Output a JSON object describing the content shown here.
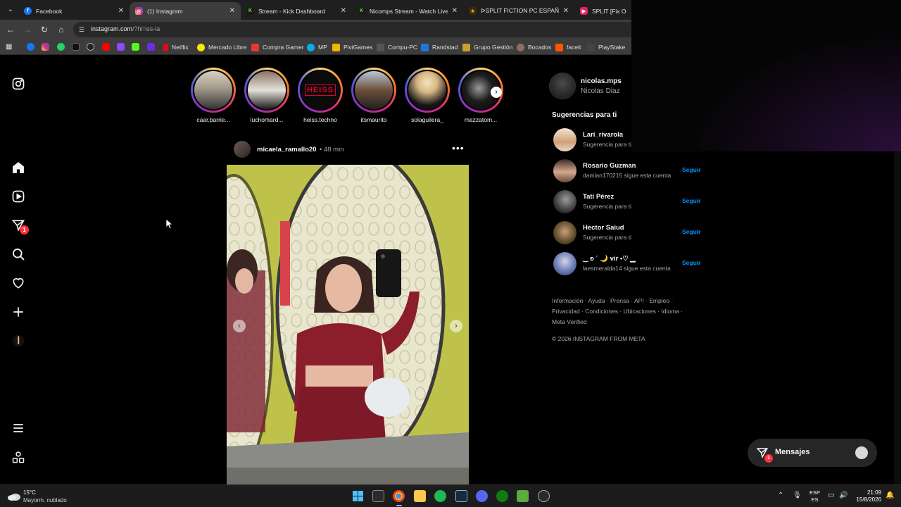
{
  "browser": {
    "tabs": [
      {
        "title": "Facebook",
        "color": "#1877f2",
        "glyph": "f",
        "active": false
      },
      {
        "title": "(1) Instagram",
        "color": "#d62976",
        "glyph": "◎",
        "active": true
      },
      {
        "title": "Stream - Kick Dashboard",
        "color": "#53fc18",
        "glyph": "K",
        "active": false
      },
      {
        "title": "Nicomps Stream - Watch Live o",
        "color": "#53fc18",
        "glyph": "K",
        "active": false
      },
      {
        "title": "ᐅSPLIT FICTION PC ESPAÑOL -",
        "color": "#f4b400",
        "glyph": "★",
        "active": false
      },
      {
        "title": "SPLIT [Fix Online",
        "color": "#e0245e",
        "glyph": "▶",
        "active": false
      }
    ],
    "url_host": "instagram.com",
    "url_path": "/?hl=es-la",
    "bookmarks": [
      "Netflix",
      "Mercado Libre",
      "Compra Gamer",
      "MP",
      "PiviGames",
      "Compu-PC",
      "Randstad",
      "Grupo Gestión",
      "Bocados",
      "faceit",
      "PlayStake"
    ]
  },
  "stories": [
    {
      "name": "caar.barrie..."
    },
    {
      "name": "luchomard..."
    },
    {
      "name": "heiss.techno"
    },
    {
      "name": "itsmaurito"
    },
    {
      "name": "solaguilera_"
    },
    {
      "name": "mazzatom..."
    }
  ],
  "heiss_logo": "HEISS",
  "post": {
    "username": "micaela_ramallo20",
    "time": "• 48 min"
  },
  "notifications_badge": "1",
  "profile": {
    "username": "nicolas.mps",
    "fullname": "Nicolas Diaz"
  },
  "suggestions": {
    "title": "Sugerencias para ti",
    "items": [
      {
        "username": "Lari_rivarola",
        "subtitle": "Sugerencia para ti",
        "follow": ""
      },
      {
        "username": "Rosario Guzman",
        "subtitle": "damian170215 sigue esta cuenta",
        "follow": "Seguir"
      },
      {
        "username": "Tati Pérez",
        "subtitle": "Sugerencia para ti",
        "follow": "Seguir"
      },
      {
        "username": "Hector Saiud",
        "subtitle": "Sugerencia para ti",
        "follow": "Seguir"
      },
      {
        "username": "‿ ᴆ ˊ 🌙 vir •♡ ▁",
        "subtitle": "laesmeralda14 sigue esta cuenta",
        "follow": "Seguir"
      }
    ]
  },
  "footer": {
    "links": "Información · Ayuda · Prensa · API · Empleo · Privacidad · Condiciones · Ubicaciones · Idioma · Meta Verified",
    "copyright": "© 2026 INSTAGRAM FROM META"
  },
  "messages": {
    "label": "Mensajes",
    "badge": "1"
  },
  "taskbar": {
    "temperature": "15°C",
    "weather": "Mayorm. nublado",
    "lang_top": "ESP",
    "lang_bottom": "ES",
    "time": "21:09",
    "date": "15/8/2026"
  }
}
